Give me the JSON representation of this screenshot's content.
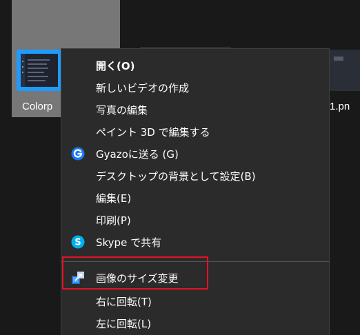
{
  "files": {
    "left_label": "Colorp",
    "right_label": "1.pn"
  },
  "context_menu": {
    "items": [
      {
        "label": "開く(O)",
        "icon": null
      },
      {
        "label": "新しいビデオの作成",
        "icon": null
      },
      {
        "label": "写真の編集",
        "icon": null
      },
      {
        "label": "ペイント 3D で編集する",
        "icon": null
      },
      {
        "label": "Gyazoに送る (G)",
        "icon": "gyazo-icon"
      },
      {
        "label": "デスクトップの背景として設定(B)",
        "icon": null
      },
      {
        "label": "編集(E)",
        "icon": null
      },
      {
        "label": "印刷(P)",
        "icon": null
      },
      {
        "label": "Skype で共有",
        "icon": "skype-icon"
      },
      {
        "label": "画像のサイズ変更",
        "icon": "image-resizer-icon"
      },
      {
        "label": "右に回転(T)",
        "icon": null
      },
      {
        "label": "左に回転(L)",
        "icon": null
      }
    ]
  },
  "colors": {
    "menu_background": "#2b2b2b",
    "highlight_border": "#e81123",
    "gyazo_blue": "#1877f2",
    "skype_blue": "#00aff0",
    "tile_selected": "#777777"
  }
}
